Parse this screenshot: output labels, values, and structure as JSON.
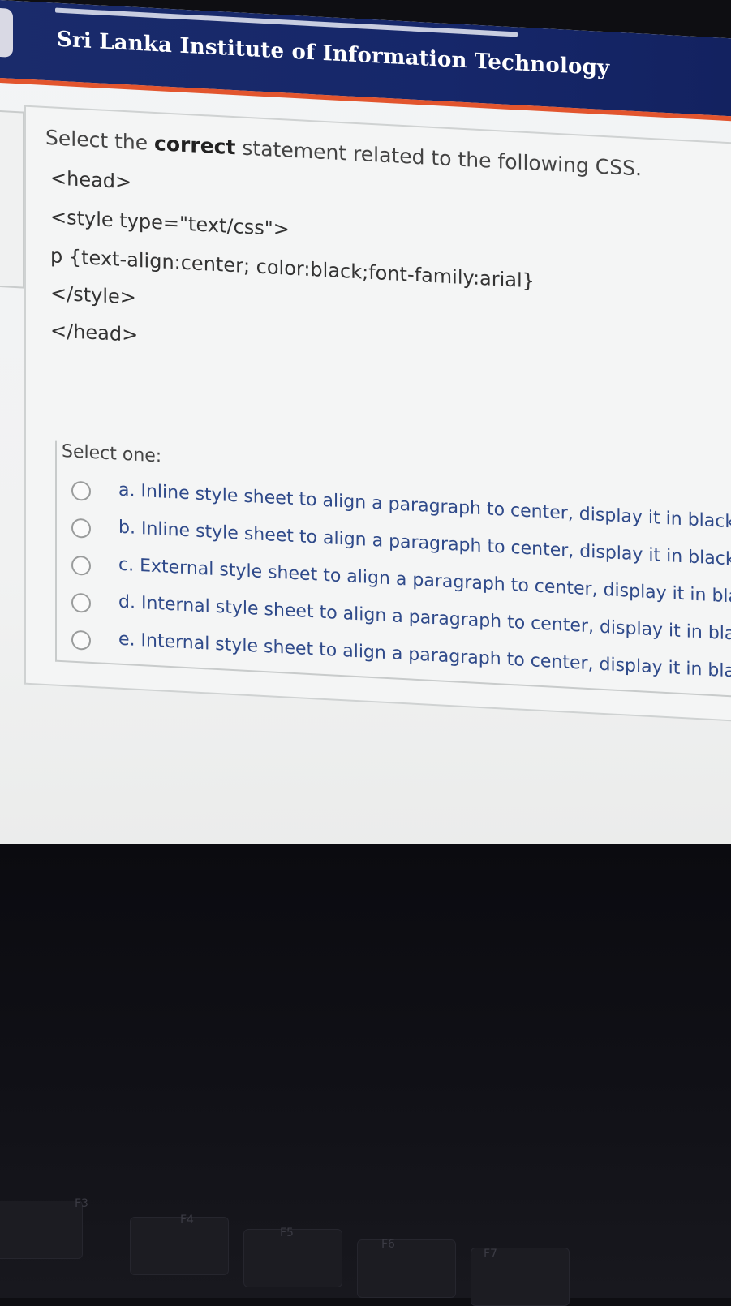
{
  "header": {
    "title": "Sri Lanka Institute of Information Technology"
  },
  "question": {
    "prefix": "Select the ",
    "emphasis": "correct",
    "suffix": " statement related to the following CSS.",
    "code_lines": [
      "<head>",
      "<style type=\"text/css\">",
      "p {text-align:center; color:black;font-family:arial}",
      "</style>",
      "</head>"
    ]
  },
  "answer": {
    "prompt": "Select one:",
    "options": [
      "a. Inline style sheet to align a paragraph to center, display it in black",
      "b. Inline style sheet to align a paragraph to center, display it in black",
      "c. External style sheet to align a paragraph to center, display it in blac",
      "d. Internal style sheet to align a paragraph to center, display it in black",
      "e. Internal style sheet to align a paragraph to center, display it in black"
    ]
  },
  "keyboard": {
    "keys": [
      "F3",
      "F4",
      "F5",
      "F6",
      "F7"
    ]
  },
  "colors": {
    "header_bg": "#1a2b6b",
    "header_accent": "#e2552e",
    "option_text": "#2f4a8a"
  }
}
